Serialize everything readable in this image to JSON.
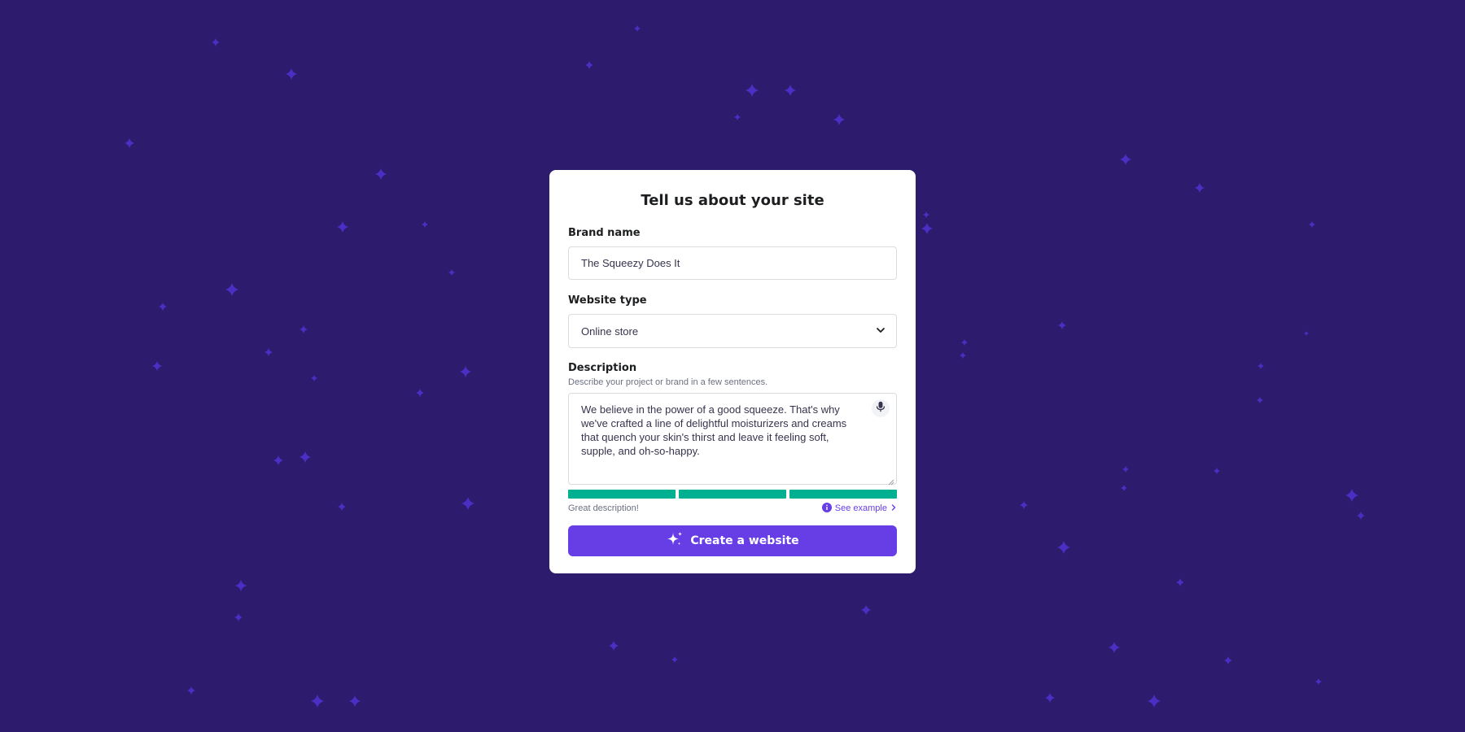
{
  "page": {
    "background_color": "#2d1c6d",
    "star_color": "#4a2fc4"
  },
  "form": {
    "title": "Tell us about your site",
    "brand_name": {
      "label": "Brand name",
      "value": "The Squeezy Does It"
    },
    "website_type": {
      "label": "Website type",
      "selected": "Online store",
      "icon": "chevron-down-icon"
    },
    "description": {
      "label": "Description",
      "hint": "Describe your project or brand in a few sentences.",
      "value": "We believe in the power of a good squeeze. That's why we've crafted a line of delightful moisturizers and creams that quench your skin's thirst and leave it feeling soft, supple, and oh-so-happy.",
      "icon": "microphone-icon"
    },
    "quality": {
      "segments_filled": 3,
      "segments_total": 3,
      "color": "#00b090",
      "message": "Great description!",
      "example_link": "See example"
    },
    "submit": {
      "label": "Create a website",
      "icon": "sparkles-icon",
      "color": "#673de6"
    }
  }
}
